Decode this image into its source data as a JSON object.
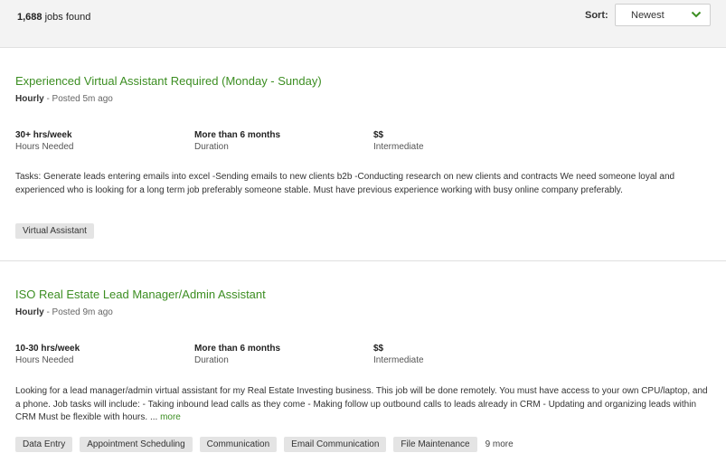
{
  "header": {
    "count": "1,688",
    "count_suffix": " jobs found",
    "sort_label": "Sort:",
    "sort_value": "Newest"
  },
  "jobs": [
    {
      "title": "Experienced Virtual Assistant Required (Monday - Sunday)",
      "type": "Hourly",
      "posted": " - Posted 5m ago",
      "hours_value": "30+ hrs/week",
      "hours_label": "Hours Needed",
      "duration_value": "More than 6 months",
      "duration_label": "Duration",
      "level_value": "$$",
      "level_label": "Intermediate",
      "description": "Tasks: Generate leads entering emails into excel -Sending emails to new clients b2b -Conducting research on new clients and contracts We need someone loyal and experienced who is looking for a long term job preferably someone stable. Must have previous experience working with busy online company preferably.",
      "tags": [
        "Virtual Assistant"
      ]
    },
    {
      "title": "ISO Real Estate Lead Manager/Admin Assistant",
      "type": "Hourly",
      "posted": " - Posted 9m ago",
      "hours_value": "10-30 hrs/week",
      "hours_label": "Hours Needed",
      "duration_value": "More than 6 months",
      "duration_label": "Duration",
      "level_value": "$$",
      "level_label": "Intermediate",
      "description": "Looking for a lead manager/admin virtual assistant for my Real Estate Investing business. This job will be done remotely. You must have access to your own CPU/laptop, and a phone. Job tasks will include: - Taking inbound lead calls as they come - Making follow up outbound calls to leads already in CRM - Updating and organizing leads within CRM Must be flexible with hours. ... ",
      "more_link": "more",
      "tags": [
        "Data Entry",
        "Appointment Scheduling",
        "Communication",
        "Email Communication",
        "File Maintenance"
      ],
      "tags_more": "9 more"
    }
  ]
}
